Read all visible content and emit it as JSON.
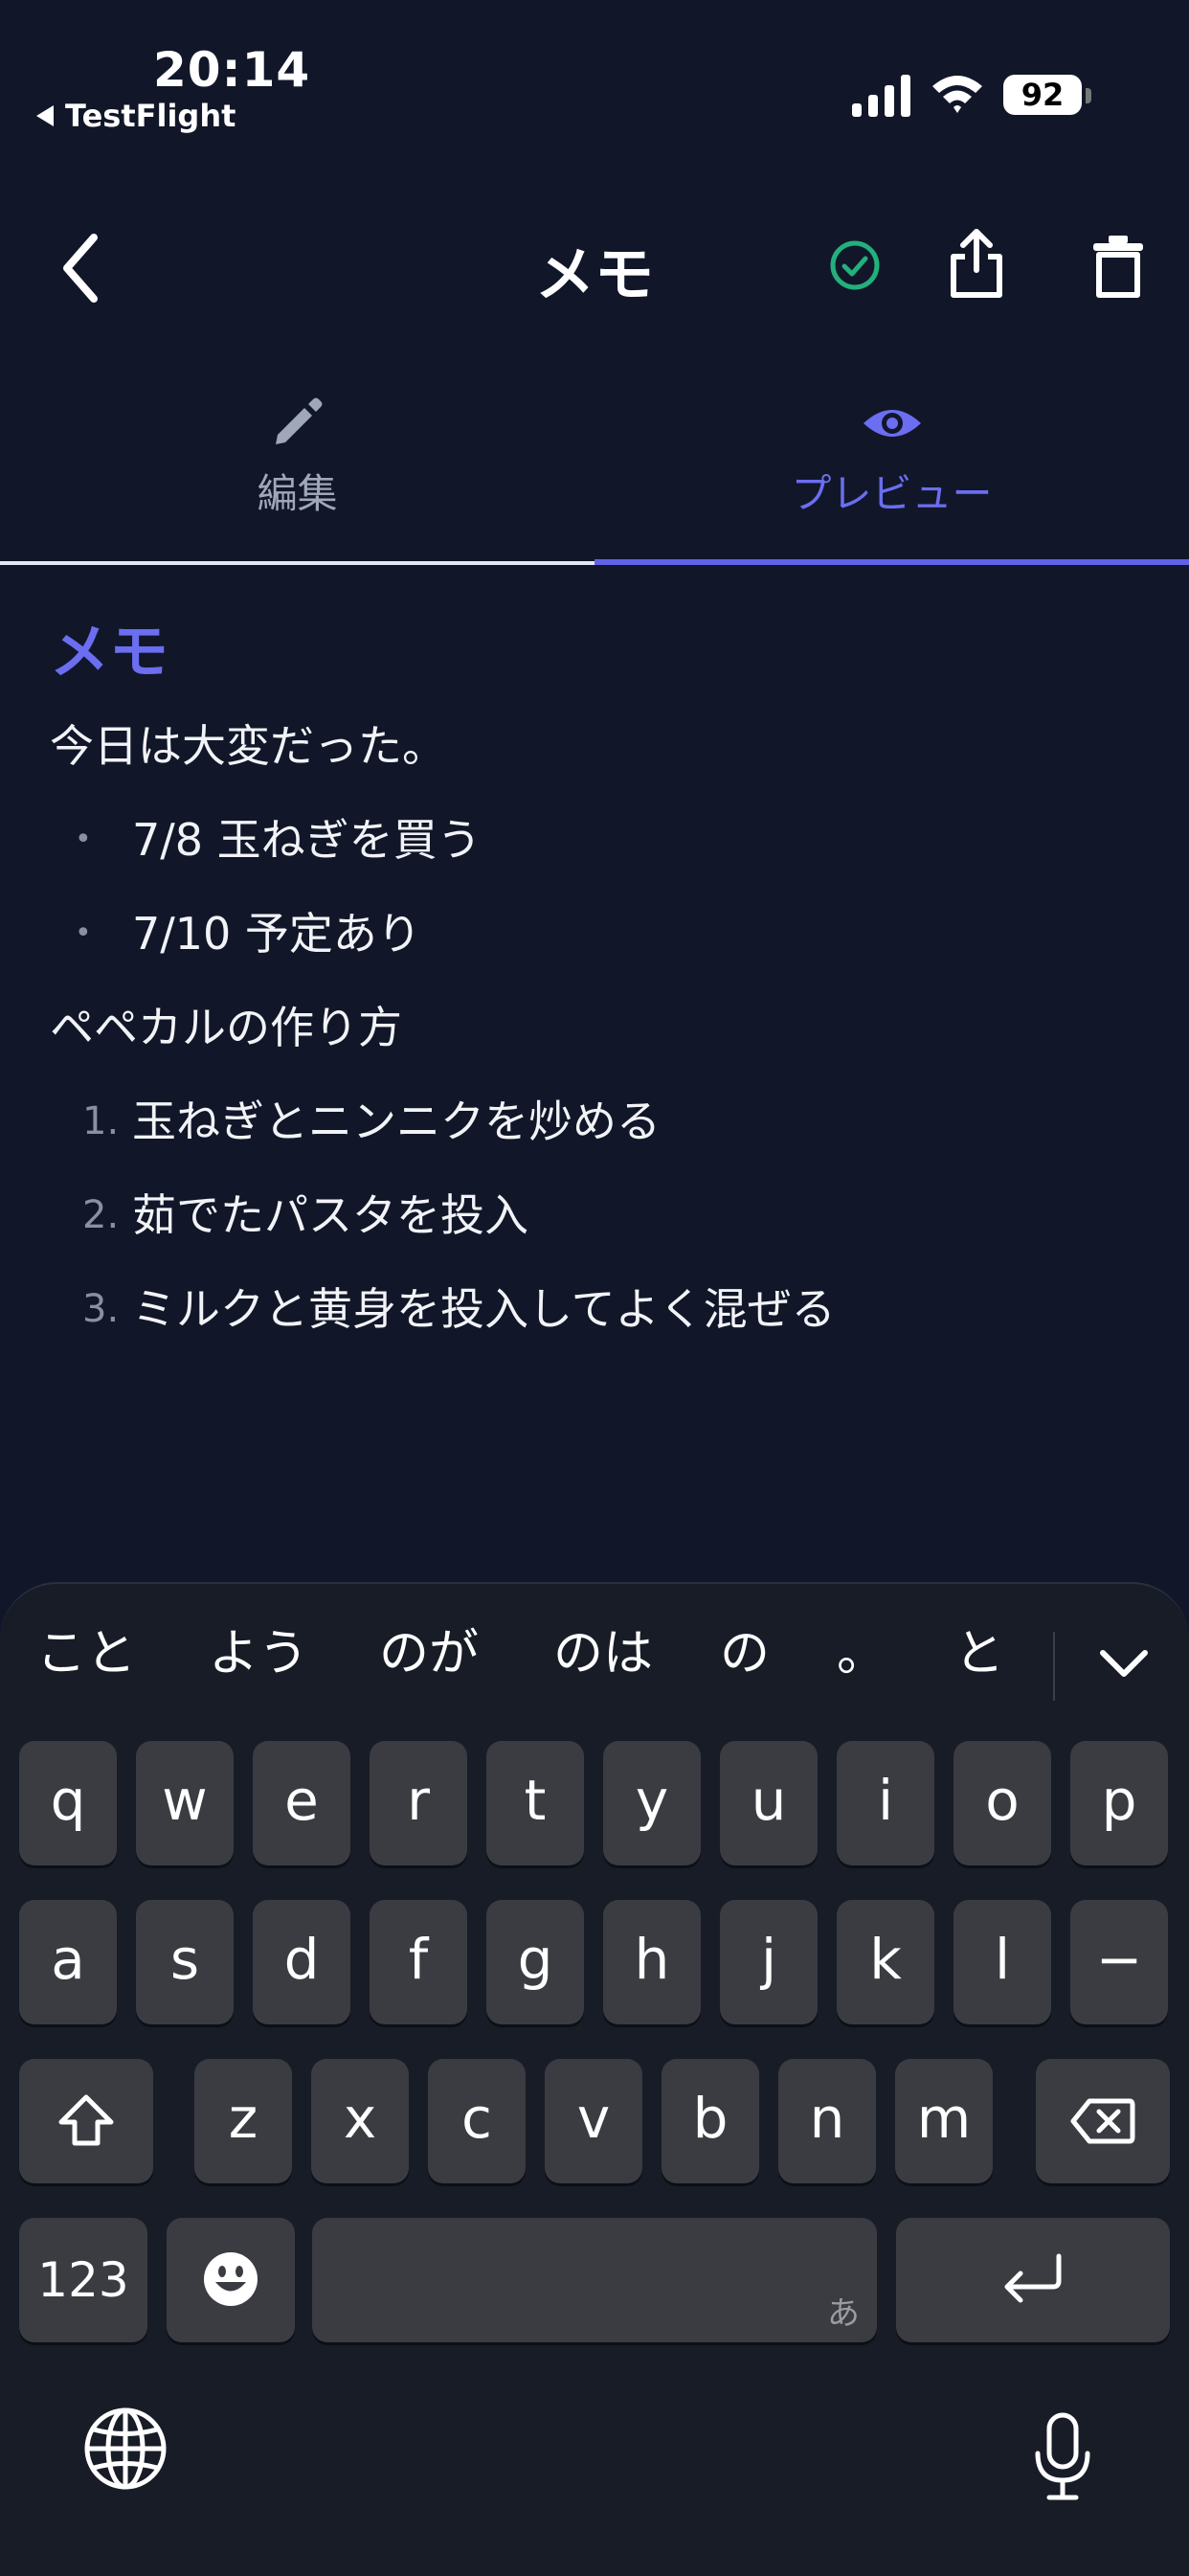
{
  "status_bar": {
    "time": "20:14",
    "back_app": "TestFlight",
    "battery": "92"
  },
  "header": {
    "title": "メモ"
  },
  "tabs": [
    {
      "label": "編集",
      "icon": "pencil-icon",
      "active": false
    },
    {
      "label": "プレビュー",
      "icon": "eye-icon",
      "active": true
    }
  ],
  "preview": {
    "heading": "メモ",
    "paragraph1": "今日は大変だった。",
    "bullets": [
      "7/8 玉ねぎを買う",
      "7/10 予定あり"
    ],
    "paragraph2": "ペペカルの作り方",
    "numbered": [
      {
        "num": "1.",
        "text": "玉ねぎとニンニクを炒める"
      },
      {
        "num": "2.",
        "text": "茹でたパスタを投入"
      },
      {
        "num": "3.",
        "text": "ミルクと黄身を投入してよく混ぜる"
      }
    ],
    "bullet_marker": "•"
  },
  "keyboard": {
    "suggestions": [
      "こと",
      "よう",
      "のが",
      "のは",
      "の",
      "。",
      "と"
    ],
    "row1": [
      "q",
      "w",
      "e",
      "r",
      "t",
      "y",
      "u",
      "i",
      "o",
      "p"
    ],
    "row2": [
      "a",
      "s",
      "d",
      "f",
      "g",
      "h",
      "j",
      "k",
      "l",
      "−"
    ],
    "row3": [
      "z",
      "x",
      "c",
      "v",
      "b",
      "n",
      "m"
    ],
    "numbers_key": "123",
    "space_hint": "あ"
  },
  "colors": {
    "background": "#111729",
    "accent": "#6b6ef0",
    "check_green": "#22b07d",
    "key": "#3a3c42"
  }
}
